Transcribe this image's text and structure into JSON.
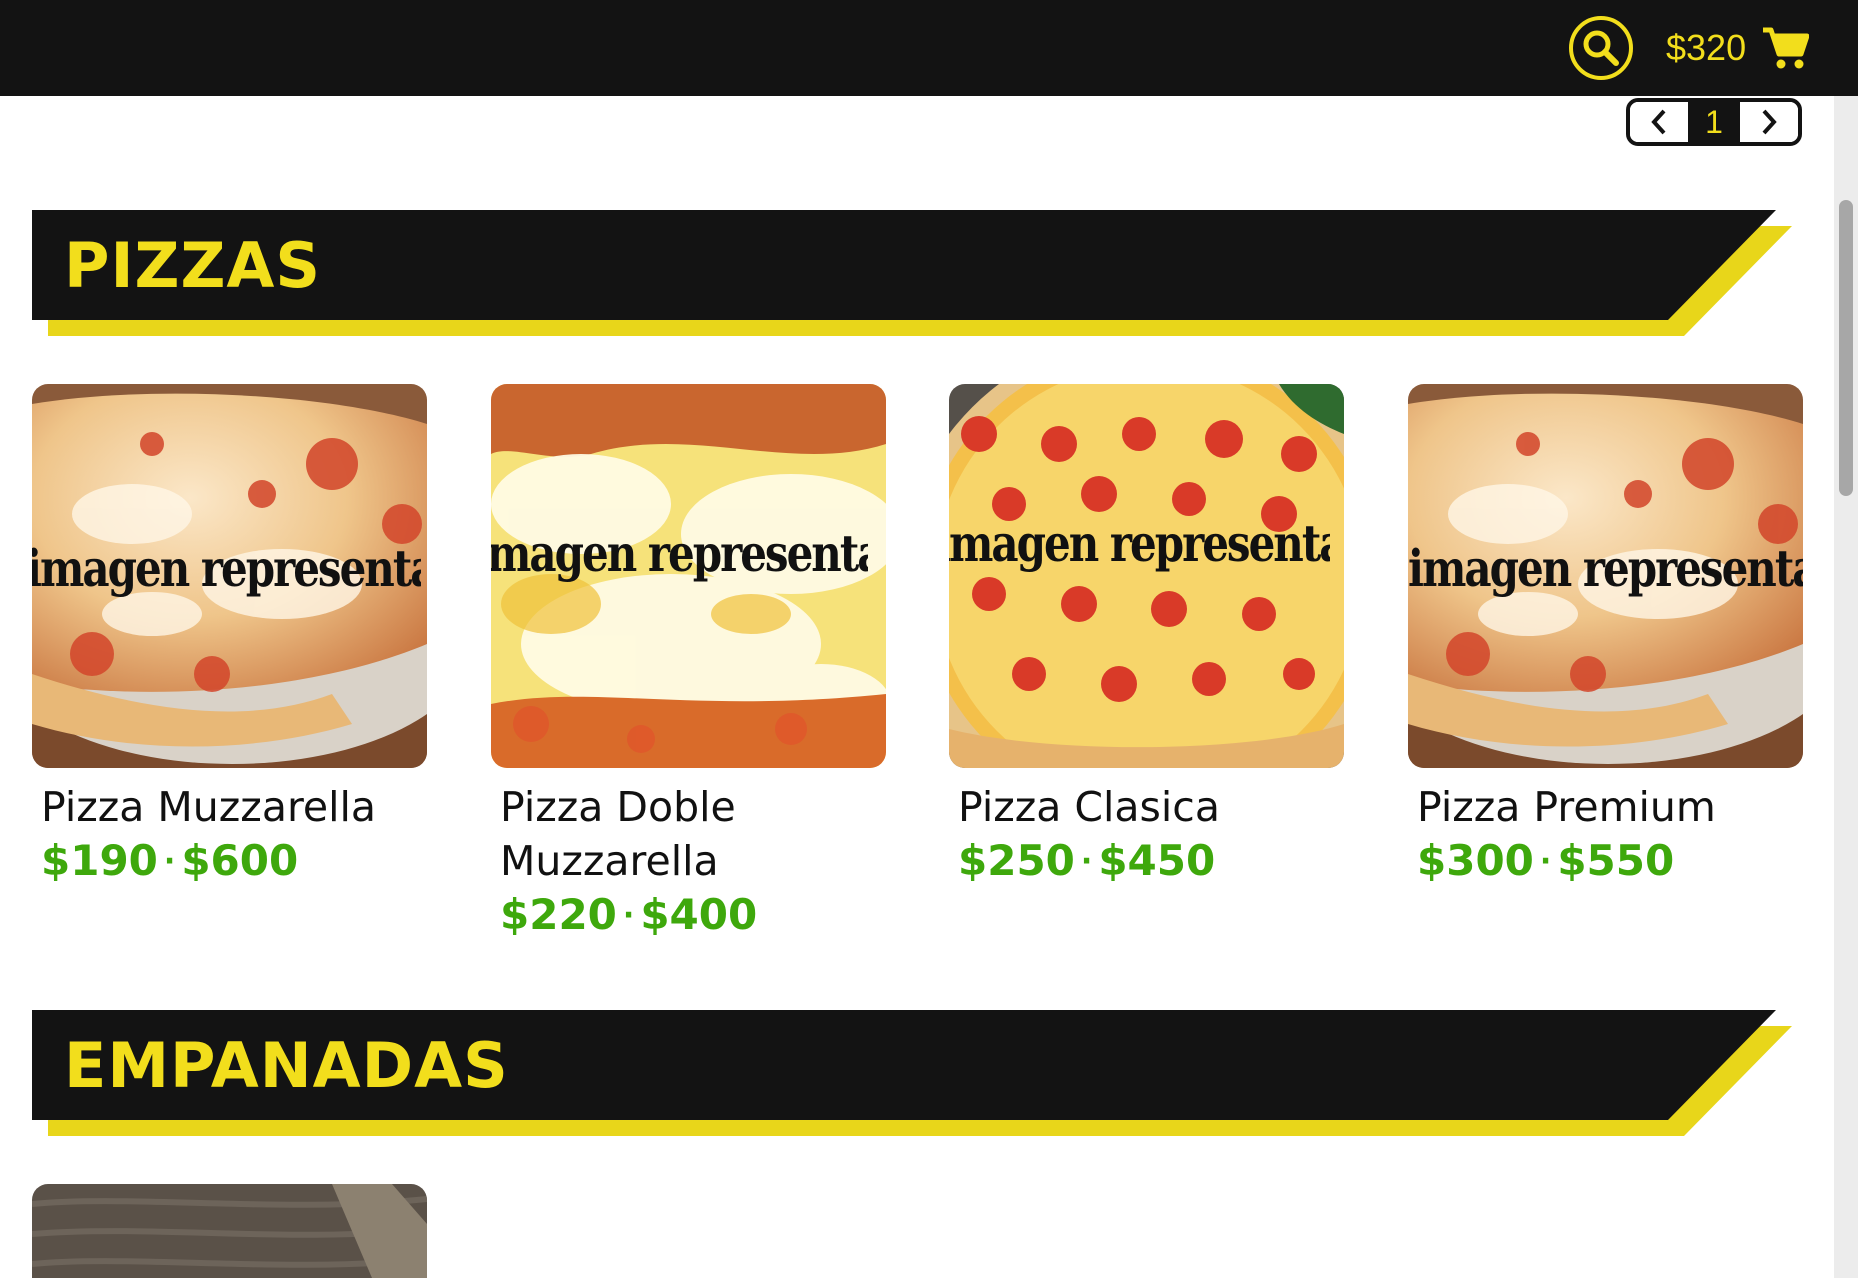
{
  "header": {
    "cart_total": "$320",
    "icons": [
      "search-icon",
      "cart-icon"
    ]
  },
  "pager": {
    "current_page": "1",
    "icons": [
      "chevron-left-icon",
      "chevron-right-icon"
    ]
  },
  "sections": [
    {
      "title": "PIZZAS",
      "products": [
        {
          "name": "Pizza Muzzarella",
          "price_small": "$190",
          "separator": "·",
          "price_large": "$600",
          "image_watermark": "imagen representativa"
        },
        {
          "name": "Pizza Doble Muzzarella",
          "price_small": "$220",
          "separator": "·",
          "price_large": "$400",
          "image_watermark": "imagen representativa"
        },
        {
          "name": "Pizza Clasica",
          "price_small": "$250",
          "separator": "·",
          "price_large": "$450",
          "image_watermark": "imagen representativa"
        },
        {
          "name": "Pizza Premium",
          "price_small": "$300",
          "separator": "·",
          "price_large": "$550",
          "image_watermark": "imagen representativa"
        }
      ]
    },
    {
      "title": "EMPANADAS",
      "products": []
    }
  ],
  "colors": {
    "bar": "#131313",
    "accent": "#f2de1c",
    "price": "#3ea80c"
  }
}
